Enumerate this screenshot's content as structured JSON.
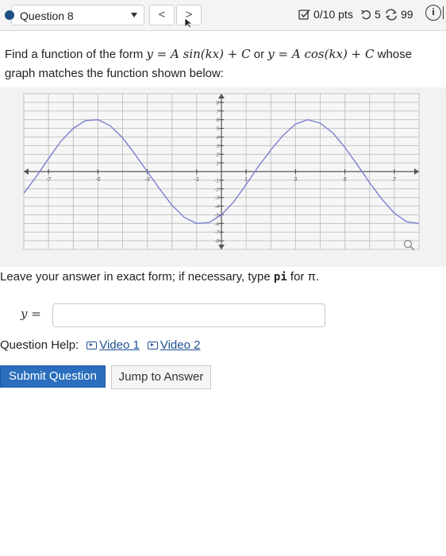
{
  "header": {
    "question_label": "Question 8",
    "prev_label": "<",
    "next_label": ">",
    "points": "0/10 pts",
    "tries_left": "5",
    "retries": "99",
    "info_label": "i"
  },
  "prompt": {
    "part1": "Find a function of the form ",
    "eq1": "y = A sin(kx) + C",
    "part2": " or ",
    "eq2": "y = A cos(kx) + C",
    "part3": " whose graph matches the function shown below:"
  },
  "chart_data": {
    "type": "line",
    "title": "",
    "xlabel": "",
    "ylabel": "",
    "xlim": [
      -8,
      8
    ],
    "ylim": [
      -9,
      9
    ],
    "x_ticks": [
      -7,
      -5,
      -3,
      -1,
      1,
      3,
      5,
      7
    ],
    "x_tick_labels": [
      "-7",
      "-5",
      "-3",
      "-1",
      "1",
      "3",
      "5",
      "7"
    ],
    "y_ticks": [
      8,
      7,
      6,
      5,
      4,
      3,
      2,
      1,
      -1,
      -2,
      -3,
      -4,
      -5,
      -6,
      -7,
      -8
    ],
    "y_tick_labels": [
      "8",
      "7",
      "6",
      "5",
      "4",
      "3",
      "2",
      "1",
      "-1",
      "-2",
      "-3",
      "-4",
      "-5",
      "-6",
      "-7",
      "-8"
    ],
    "grid": true,
    "series": [
      {
        "color": "#7b7fd0",
        "x": [
          -8,
          -7.5,
          -7,
          -6.5,
          -6,
          -5.5,
          -5,
          -4.5,
          -4,
          -3.5,
          -3,
          -2.5,
          -2,
          -1.5,
          -1,
          -0.5,
          0,
          0.5,
          1,
          1.5,
          2,
          2.5,
          3,
          3.5,
          4,
          4.5,
          5,
          5.5,
          6,
          6.5,
          7,
          7.5,
          8
        ],
        "y": [
          -2.5,
          -0.6,
          1.5,
          3.5,
          5.0,
          5.9,
          6.0,
          5.3,
          3.9,
          2.0,
          0.0,
          -2.0,
          -3.9,
          -5.3,
          -6.0,
          -5.9,
          -5.0,
          -3.5,
          -1.5,
          0.6,
          2.5,
          4.2,
          5.5,
          6.0,
          5.6,
          4.5,
          2.8,
          0.8,
          -1.3,
          -3.2,
          -4.8,
          -5.8,
          -6.0
        ]
      }
    ]
  },
  "instruction": {
    "part1": "Leave your answer in exact form; if necessary, type ",
    "code": "pi",
    "part2": " for π."
  },
  "answer": {
    "label": "y =",
    "value": "",
    "placeholder": ""
  },
  "help": {
    "label": "Question Help:",
    "video1": "Video 1",
    "video2": "Video 2"
  },
  "buttons": {
    "submit": "Submit Question",
    "jump": "Jump to Answer"
  },
  "colors": {
    "accent": "#2a6ebd",
    "curve": "#7b7fd0",
    "question_dot": "#1f4f86"
  }
}
